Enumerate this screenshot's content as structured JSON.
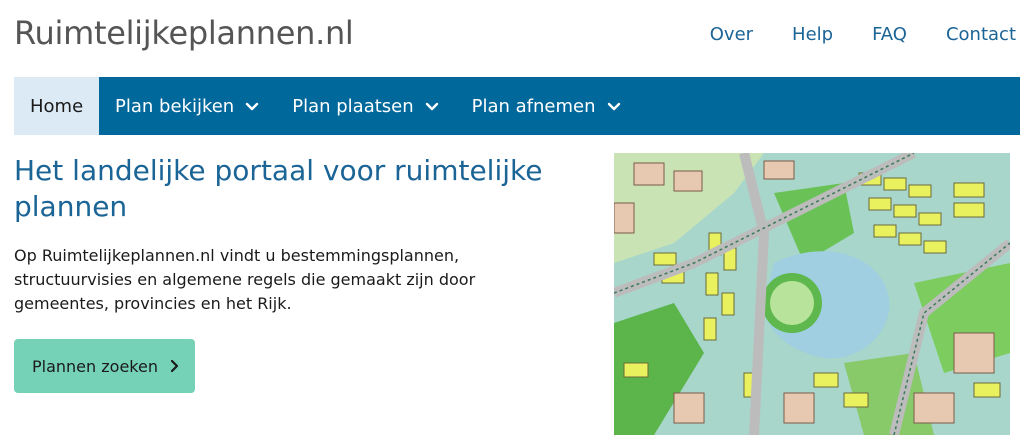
{
  "header": {
    "logo": "Ruimtelijkeplannen.nl",
    "links": [
      "Over",
      "Help",
      "FAQ",
      "Contact"
    ]
  },
  "nav": {
    "home": "Home",
    "items": [
      "Plan bekijken",
      "Plan plaatsen",
      "Plan afnemen"
    ]
  },
  "hero": {
    "title": "Het landelijke portaal voor ruimtelijke plannen",
    "text": "Op Ruimtelijkeplannen.nl vindt u bestemmingsplannen, structuurvisies en algemene regels die gemaakt zijn door gemeentes, provincies en het Rijk.",
    "button": "Plannen zoeken"
  },
  "icons": {
    "nav_dropdown": "chevron-down-icon",
    "button": "chevron-right-icon",
    "map": "zoning-map-image"
  },
  "colors": {
    "nav": "#01689b",
    "nav_active": "#dbeaf5",
    "link": "#1b6496",
    "button": "#76d2b6"
  }
}
